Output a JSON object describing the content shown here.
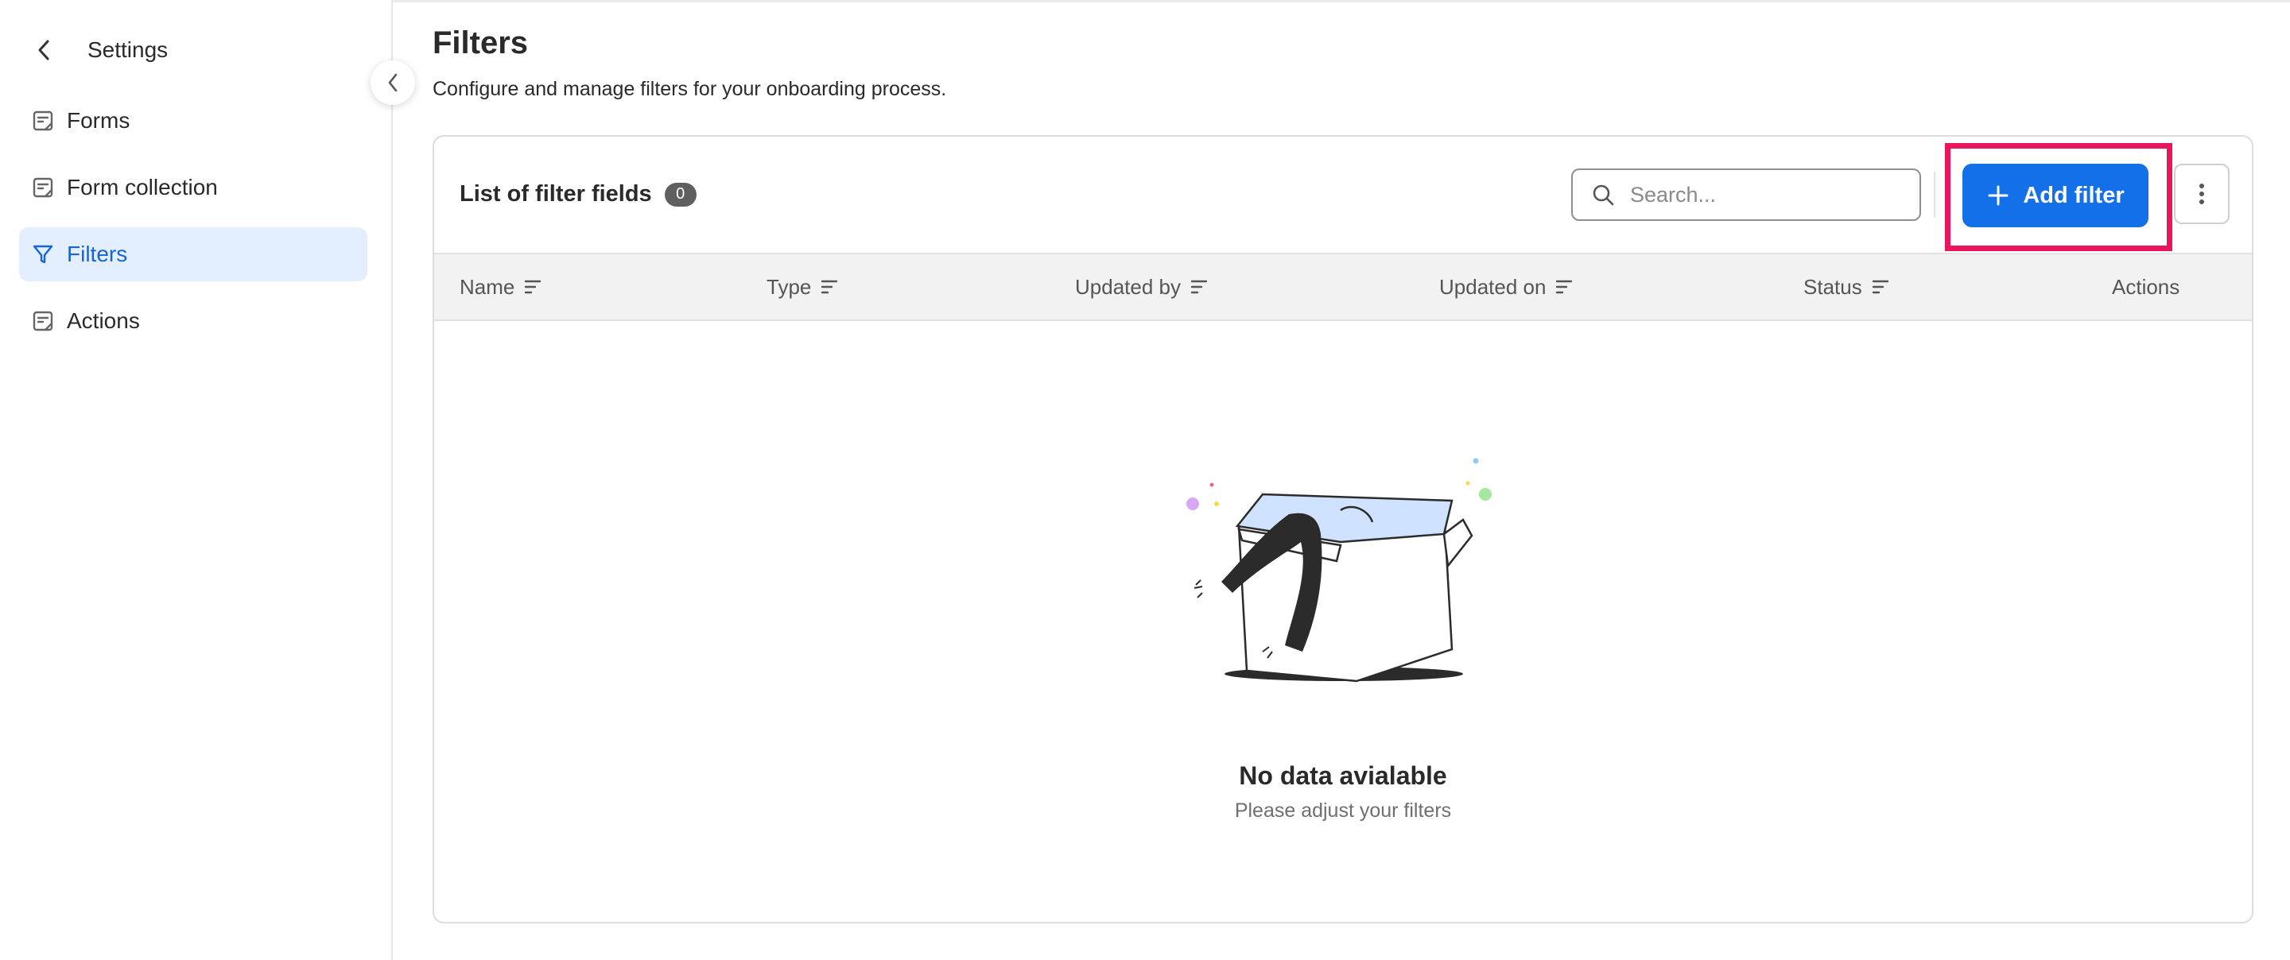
{
  "sidebar": {
    "title": "Settings",
    "items": [
      {
        "label": "Forms",
        "icon": "form-icon",
        "active": false
      },
      {
        "label": "Form collection",
        "icon": "form-icon",
        "active": false
      },
      {
        "label": "Filters",
        "icon": "filter-icon",
        "active": true
      },
      {
        "label": "Actions",
        "icon": "form-icon",
        "active": false
      }
    ]
  },
  "page": {
    "title": "Filters",
    "subtitle": "Configure and manage filters for your onboarding process."
  },
  "list": {
    "title": "List of filter fields",
    "count": "0",
    "search_placeholder": "Search...",
    "add_label": "Add filter",
    "columns": [
      "Name",
      "Type",
      "Updated by",
      "Updated on",
      "Status",
      "Actions"
    ]
  },
  "empty": {
    "title": "No data avialable",
    "subtitle": "Please adjust your filters"
  },
  "colors": {
    "accent": "#1470e8",
    "active_bg": "#e3efff",
    "highlight": "#e8175d"
  }
}
